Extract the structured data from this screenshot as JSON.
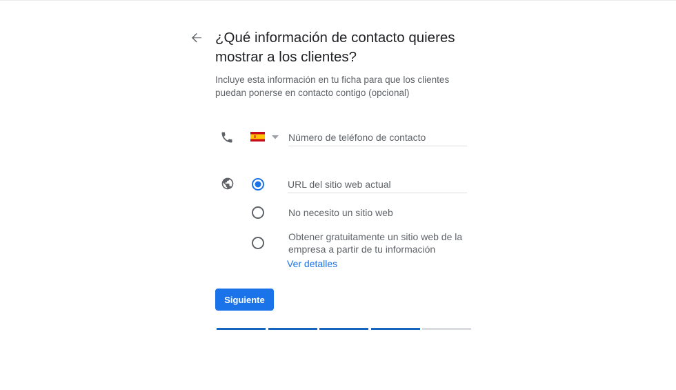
{
  "header": {
    "title": "¿Qué información de contacto quieres mostrar a los clientes?",
    "subtitle": "Incluye esta información en tu ficha para que los clientes puedan ponerse en contacto contigo (opcional)"
  },
  "phone": {
    "country": "ES",
    "placeholder": "Número de teléfono de contacto",
    "value": ""
  },
  "website": {
    "url_placeholder": "URL del sitio web actual",
    "url_value": "",
    "selected_option": "url",
    "options": [
      {
        "id": "url",
        "label": "URL del sitio web actual",
        "selected": true
      },
      {
        "id": "none",
        "label": "No necesito un sitio web",
        "selected": false
      },
      {
        "id": "free",
        "label": "Obtener gratuitamente un sitio web de la empresa a partir de tu información",
        "selected": false
      }
    ],
    "details_link": "Ver detalles"
  },
  "actions": {
    "next_label": "Siguiente"
  },
  "progress": {
    "total_steps": 5,
    "completed_steps": 4
  },
  "colors": {
    "accent": "#1a73e8",
    "progress_done": "#1565c0",
    "progress_pending": "#dadce0",
    "text_primary": "#202124",
    "text_secondary": "#5f6368",
    "icon": "#5f6368"
  },
  "icons": {
    "back": "arrow-back-icon",
    "phone": "phone-icon",
    "globe": "globe-icon",
    "caret": "caret-down-icon",
    "flag": "spain-flag-icon"
  }
}
